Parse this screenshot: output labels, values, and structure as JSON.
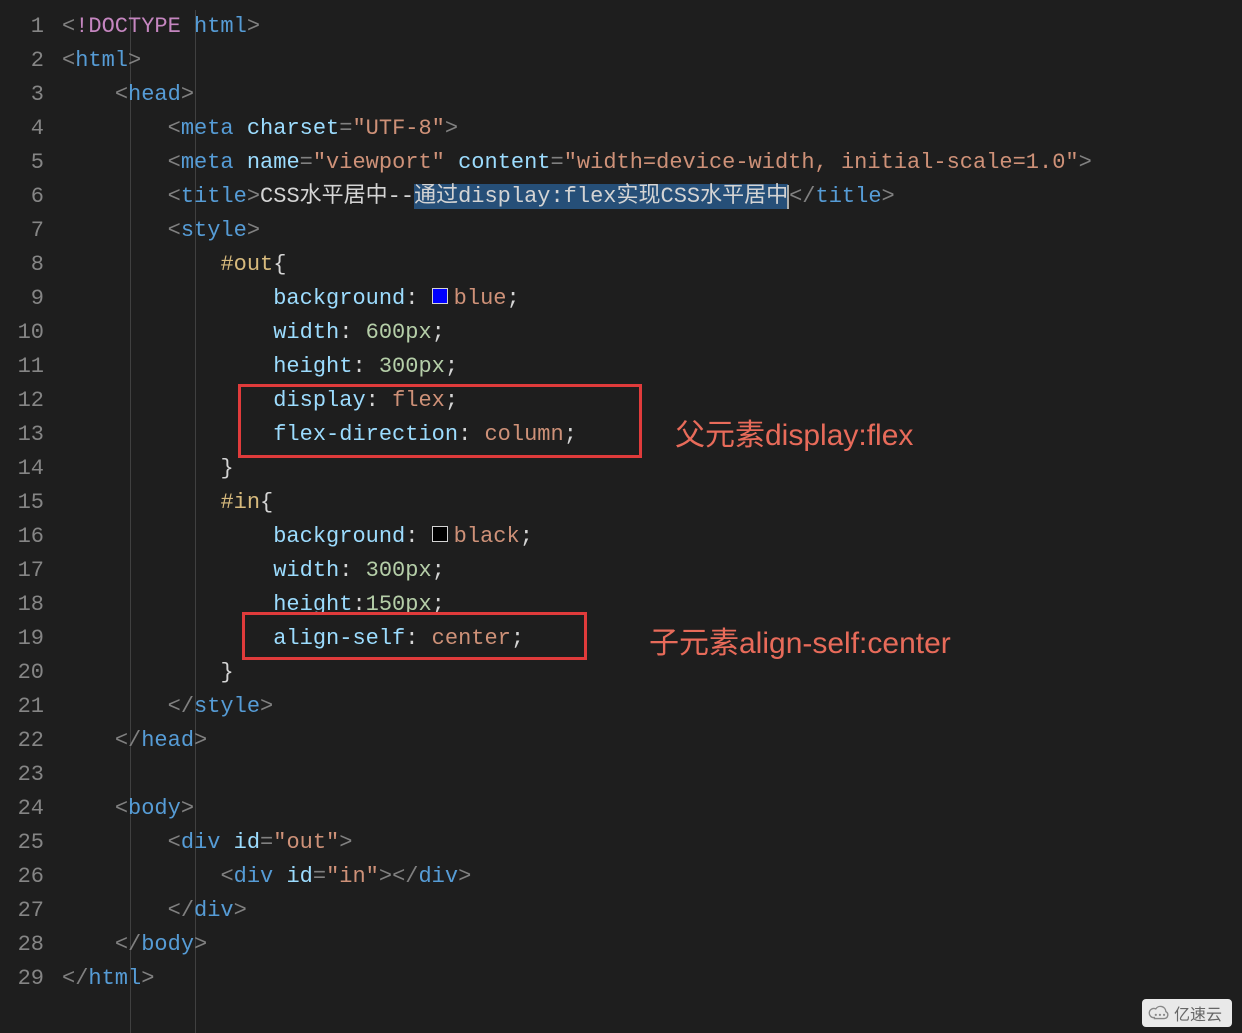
{
  "lines_total": 29,
  "code": {
    "l1": {
      "doctype": "!DOCTYPE",
      "html": "html"
    },
    "l2": {
      "tag": "html"
    },
    "l3": {
      "tag": "head"
    },
    "l4": {
      "tag": "meta",
      "attr": "charset",
      "val": "\"UTF-8\""
    },
    "l5": {
      "tag": "meta",
      "a1": "name",
      "v1": "\"viewport\"",
      "a2": "content",
      "v2": "\"width=device-width, initial-scale=1.0\""
    },
    "l6": {
      "tag": "title",
      "text_a": "CSS水平居中--",
      "text_sel": "通过display:flex实现CSS水平居中"
    },
    "l7": {
      "tag": "style"
    },
    "l8": {
      "sel": "#out",
      "brace": "{"
    },
    "l9": {
      "prop": "background",
      "swatch": "#0000ff",
      "val": "blue"
    },
    "l10": {
      "prop": "width",
      "num": "600px"
    },
    "l11": {
      "prop": "height",
      "num": "300px"
    },
    "l12": {
      "prop": "display",
      "val": "flex"
    },
    "l13": {
      "prop": "flex-direction",
      "val": "column"
    },
    "l14": {
      "brace": "}"
    },
    "l15": {
      "sel": "#in",
      "brace": "{"
    },
    "l16": {
      "prop": "background",
      "swatch": "#000000",
      "val": "black"
    },
    "l17": {
      "prop": "width",
      "num": "300px"
    },
    "l18": {
      "prop": "height",
      "num": "150px"
    },
    "l19": {
      "prop": "align-self",
      "val": "center"
    },
    "l20": {
      "brace": "}"
    },
    "l21": {
      "tag": "style"
    },
    "l22": {
      "tag": "head"
    },
    "l24": {
      "tag": "body"
    },
    "l25": {
      "tag": "div",
      "attr": "id",
      "val": "\"out\""
    },
    "l26": {
      "tag": "div",
      "attr": "id",
      "val": "\"in\""
    },
    "l27": {
      "tag": "div"
    },
    "l28": {
      "tag": "body"
    },
    "l29": {
      "tag": "html"
    }
  },
  "annotations": {
    "a1": "父元素display:flex",
    "a2": "子元素align-self:center"
  },
  "watermark": "亿速云"
}
